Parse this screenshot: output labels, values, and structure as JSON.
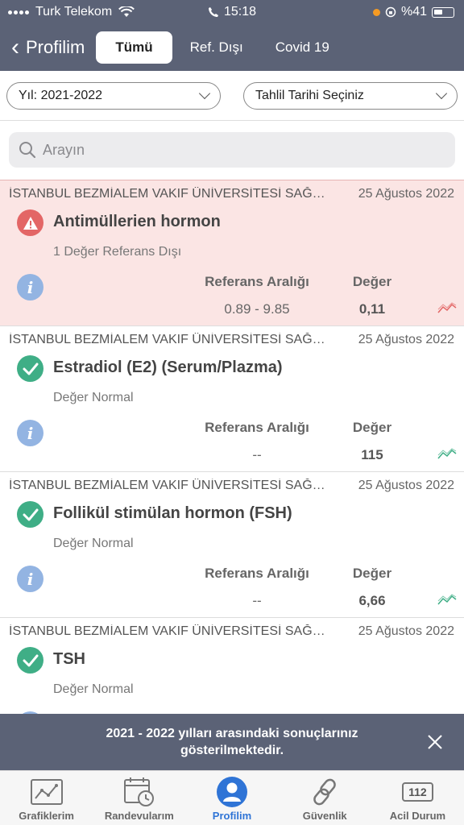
{
  "status_bar": {
    "carrier": "Turk Telekom",
    "time": "15:18",
    "battery": "%41"
  },
  "header": {
    "back_label": "Profilim",
    "tabs": [
      {
        "label": "Tümü",
        "active": true
      },
      {
        "label": "Ref. Dışı",
        "active": false
      },
      {
        "label": "Covid 19",
        "active": false
      }
    ]
  },
  "filters": {
    "year": "Yıl: 2021-2022",
    "date": "Tahlil Tarihi Seçiniz"
  },
  "search": {
    "placeholder": "Arayın"
  },
  "columns": {
    "reference": "Referans Aralığı",
    "value": "Değer"
  },
  "results": [
    {
      "hospital": "İSTANBUL BEZMİALEM VAKIF ÜNİVERSİTESİ SAĞLIK UYGULAMA VE ARAŞTIRMA MERKEZİ",
      "date": "25 Ağustos 2022",
      "test": "Antimüllerien hormon",
      "status": "1 Değer Referans Dışı",
      "reference_range": "0.89 - 9.85",
      "value": "0,11",
      "out_of_range": true
    },
    {
      "hospital": "İSTANBUL BEZMİALEM VAKIF ÜNİVERSİTESİ SAĞLIK UYGULAMA VE ARAŞTIRMA MERKEZİ",
      "date": "25 Ağustos 2022",
      "test": "Estradiol (E2) (Serum/Plazma)",
      "status": "Değer Normal",
      "reference_range": "--",
      "value": "115",
      "out_of_range": false
    },
    {
      "hospital": "İSTANBUL BEZMİALEM VAKIF ÜNİVERSİTESİ SAĞLIK UYGULAMA VE ARAŞTIRMA MERKEZİ",
      "date": "25 Ağustos 2022",
      "test": "Follikül stimülan hormon (FSH)",
      "status": "Değer Normal",
      "reference_range": "--",
      "value": "6,66",
      "out_of_range": false
    },
    {
      "hospital": "İSTANBUL BEZMİALEM VAKIF ÜNİVERSİTESİ SAĞLIK UYGULAMA VE ARAŞTIRMA MERKEZİ",
      "date": "25 Ağustos 2022",
      "test": "TSH",
      "status": "Değer Normal",
      "reference_range": "",
      "value": "",
      "out_of_range": false
    }
  ],
  "banner": {
    "text": "2021 - 2022 yılları arasındaki sonuçlarınız gösterilmektedir."
  },
  "tab_bar": [
    {
      "label": "Grafiklerim",
      "icon": "chart-icon",
      "active": false
    },
    {
      "label": "Randevularım",
      "icon": "calendar-clock-icon",
      "active": false
    },
    {
      "label": "Profilim",
      "icon": "profile-icon",
      "active": true
    },
    {
      "label": "Güvenlik",
      "icon": "chain-link-icon",
      "active": false
    },
    {
      "label": "Acil Durum",
      "icon": "emergency-112-icon",
      "active": false,
      "badge": "112"
    }
  ],
  "colors": {
    "header_bg": "#5b6276",
    "alert_bg": "#fbe5e4",
    "ok_green": "#3fae86",
    "warn_red": "#e36666",
    "info_blue": "#93b4e2",
    "active_tab": "#2f74d6"
  }
}
